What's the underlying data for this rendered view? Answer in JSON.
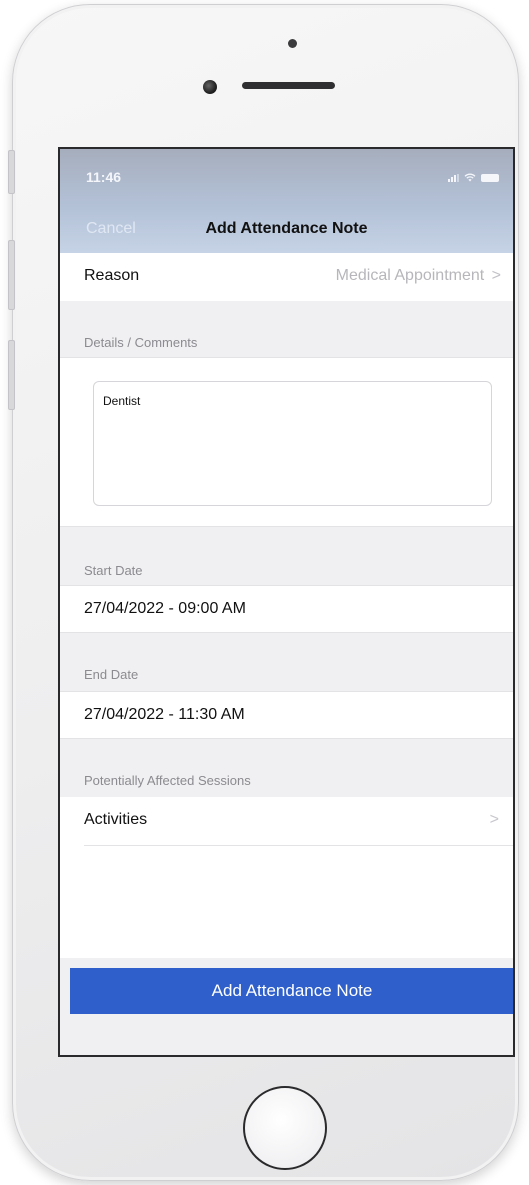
{
  "status_bar": {
    "time": "11:46"
  },
  "nav": {
    "cancel_label": "Cancel",
    "title": "Add Attendance Note"
  },
  "reason": {
    "label": "Reason",
    "value": "Medical Appointment",
    "chevron": ">"
  },
  "details": {
    "section_label": "Details / Comments",
    "text": "Dentist"
  },
  "start_date": {
    "section_label": "Start Date",
    "value": "27/04/2022 - 09:00 AM"
  },
  "end_date": {
    "section_label": "End Date",
    "value": "27/04/2022 - 11:30 AM"
  },
  "sessions": {
    "section_label": "Potentially Affected Sessions",
    "item_label": "Activities",
    "chevron": ">"
  },
  "actions": {
    "submit_label": "Add Attendance Note"
  },
  "colors": {
    "accent": "#2f5fca",
    "nav_bar": "#b3c1d7",
    "section_background": "#f0f0f2"
  },
  "icons": [
    "signal-icon",
    "wifi-icon",
    "battery-icon",
    "chevron-right-icon"
  ]
}
